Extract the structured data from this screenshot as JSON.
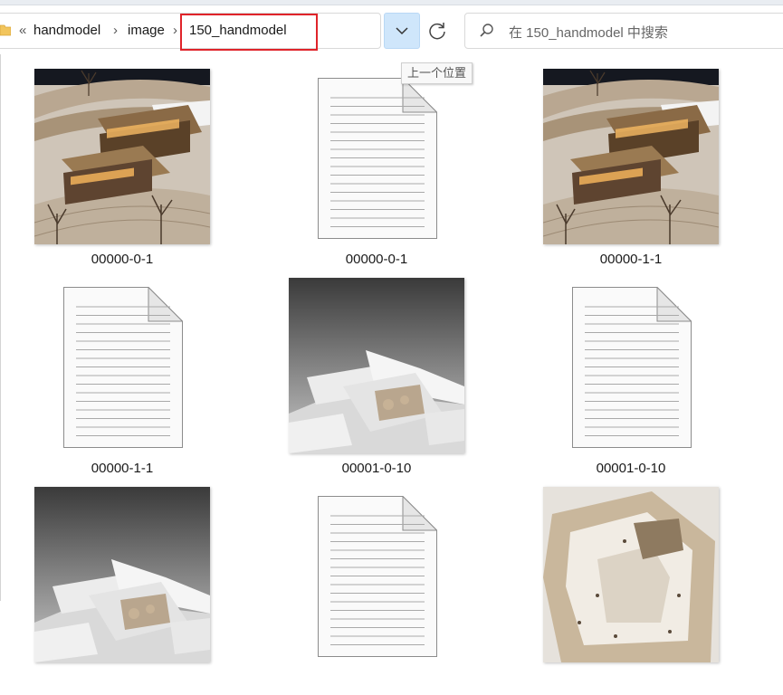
{
  "breadcrumb": {
    "overflow": "«",
    "items": [
      "handmodel",
      "image",
      "150_handmodel"
    ],
    "separator": "›"
  },
  "search": {
    "placeholder": "在 150_handmodel 中搜索"
  },
  "tooltip": "上一个位置",
  "files": [
    {
      "name": "00000-0-1",
      "kind": "image",
      "scene": "wood-terrace"
    },
    {
      "name": "00000-0-1",
      "kind": "text"
    },
    {
      "name": "00000-1-1",
      "kind": "image",
      "scene": "wood-terrace"
    },
    {
      "name": "00000-1-1",
      "kind": "text"
    },
    {
      "name": "00001-0-10",
      "kind": "image",
      "scene": "white-cross"
    },
    {
      "name": "00001-0-10",
      "kind": "text"
    },
    {
      "name": "",
      "kind": "image",
      "scene": "white-cross"
    },
    {
      "name": "",
      "kind": "text"
    },
    {
      "name": "",
      "kind": "image",
      "scene": "beige-courtyard"
    }
  ],
  "colors": {
    "highlight": "#e0242a",
    "dropdown": "#cfe6fb"
  }
}
